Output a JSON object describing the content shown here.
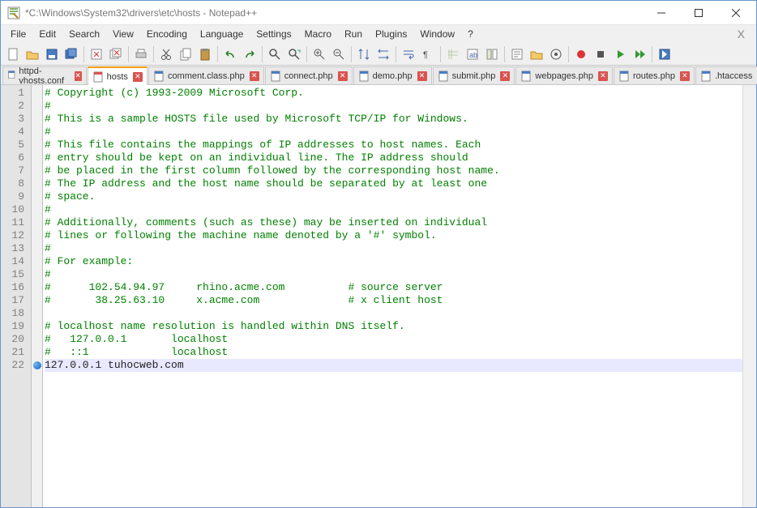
{
  "title": "*C:\\Windows\\System32\\drivers\\etc\\hosts - Notepad++",
  "menu": {
    "file": "File",
    "edit": "Edit",
    "search": "Search",
    "view": "View",
    "encoding": "Encoding",
    "language": "Language",
    "settings": "Settings",
    "macro": "Macro",
    "run": "Run",
    "plugins": "Plugins",
    "window": "Window",
    "help": "?"
  },
  "tabs": [
    {
      "label": "httpd-vhosts.conf",
      "modified": false,
      "active": false
    },
    {
      "label": "hosts",
      "modified": true,
      "active": true
    },
    {
      "label": "comment.class.php",
      "modified": false,
      "active": false
    },
    {
      "label": "connect.php",
      "modified": false,
      "active": false
    },
    {
      "label": "demo.php",
      "modified": false,
      "active": false
    },
    {
      "label": "submit.php",
      "modified": false,
      "active": false
    },
    {
      "label": "webpages.php",
      "modified": false,
      "active": false
    },
    {
      "label": "routes.php",
      "modified": false,
      "active": false
    },
    {
      "label": ".htaccess",
      "modified": false,
      "active": false
    }
  ],
  "code": {
    "lines": [
      {
        "n": 1,
        "t": "# Copyright (c) 1993-2009 Microsoft Corp.",
        "c": true
      },
      {
        "n": 2,
        "t": "#",
        "c": true
      },
      {
        "n": 3,
        "t": "# This is a sample HOSTS file used by Microsoft TCP/IP for Windows.",
        "c": true
      },
      {
        "n": 4,
        "t": "#",
        "c": true
      },
      {
        "n": 5,
        "t": "# This file contains the mappings of IP addresses to host names. Each",
        "c": true
      },
      {
        "n": 6,
        "t": "# entry should be kept on an individual line. The IP address should",
        "c": true
      },
      {
        "n": 7,
        "t": "# be placed in the first column followed by the corresponding host name.",
        "c": true
      },
      {
        "n": 8,
        "t": "# The IP address and the host name should be separated by at least one",
        "c": true
      },
      {
        "n": 9,
        "t": "# space.",
        "c": true
      },
      {
        "n": 10,
        "t": "#",
        "c": true
      },
      {
        "n": 11,
        "t": "# Additionally, comments (such as these) may be inserted on individual",
        "c": true
      },
      {
        "n": 12,
        "t": "# lines or following the machine name denoted by a '#' symbol.",
        "c": true
      },
      {
        "n": 13,
        "t": "#",
        "c": true
      },
      {
        "n": 14,
        "t": "# For example:",
        "c": true
      },
      {
        "n": 15,
        "t": "#",
        "c": true
      },
      {
        "n": 16,
        "t": "#      102.54.94.97     rhino.acme.com          # source server",
        "c": true
      },
      {
        "n": 17,
        "t": "#       38.25.63.10     x.acme.com              # x client host",
        "c": true
      },
      {
        "n": 18,
        "t": "",
        "c": false
      },
      {
        "n": 19,
        "t": "# localhost name resolution is handled within DNS itself.",
        "c": true
      },
      {
        "n": 20,
        "t": "#   127.0.0.1       localhost",
        "c": true
      },
      {
        "n": 21,
        "t": "#   ::1             localhost",
        "c": true
      },
      {
        "n": 22,
        "t": "127.0.0.1 tuhocweb.com",
        "c": false,
        "hl": true,
        "marker": true
      }
    ]
  },
  "toolbar_icons": [
    "new-file",
    "open-file",
    "save",
    "save-all",
    "sep",
    "close",
    "close-all",
    "sep",
    "print",
    "sep",
    "cut",
    "copy",
    "paste",
    "sep",
    "undo",
    "redo",
    "sep",
    "find",
    "replace",
    "sep",
    "zoom-in",
    "zoom-out",
    "sep",
    "sync-v",
    "sync-h",
    "sep",
    "word-wrap",
    "show-all",
    "sep",
    "indent-guide",
    "lang",
    "doc-map",
    "sep",
    "func-list",
    "folder",
    "monitoring",
    "sep",
    "record",
    "stop",
    "play",
    "play-multi",
    "sep",
    "save-macro"
  ]
}
